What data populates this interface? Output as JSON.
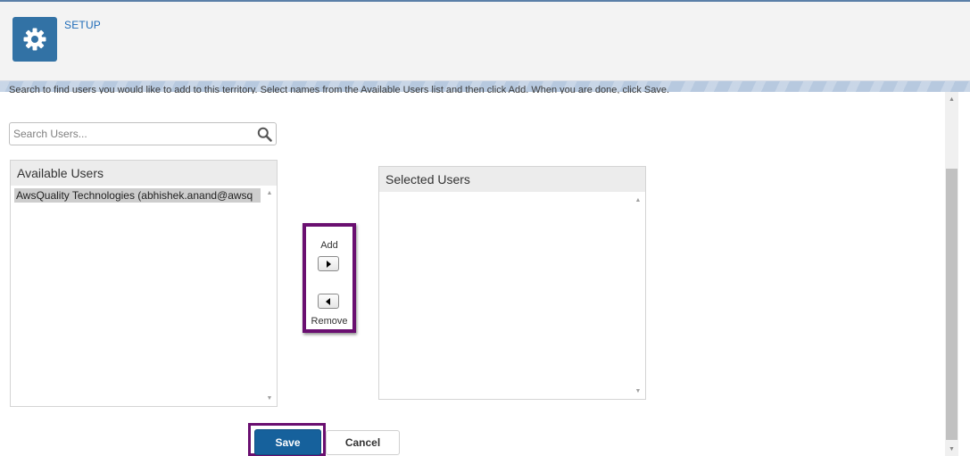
{
  "header": {
    "title": "SETUP",
    "icon": "gear-icon",
    "accent_color": "#3272a5"
  },
  "instructions": "Search to find users you would like to add to this territory. Select names from the Available Users list and then click Add. When you are done, click Save.",
  "search": {
    "placeholder": "Search Users...",
    "value": "",
    "icon": "search-icon"
  },
  "available_users": {
    "title": "Available Users",
    "items": [
      {
        "label": "AwsQuality Technologies (abhishek.anand@awsq",
        "selected": true
      }
    ]
  },
  "selected_users": {
    "title": "Selected Users",
    "items": []
  },
  "move": {
    "add_label": "Add",
    "remove_label": "Remove"
  },
  "actions": {
    "save_label": "Save",
    "cancel_label": "Cancel",
    "save_color": "#16619c",
    "highlight_color": "#6a0f70"
  }
}
